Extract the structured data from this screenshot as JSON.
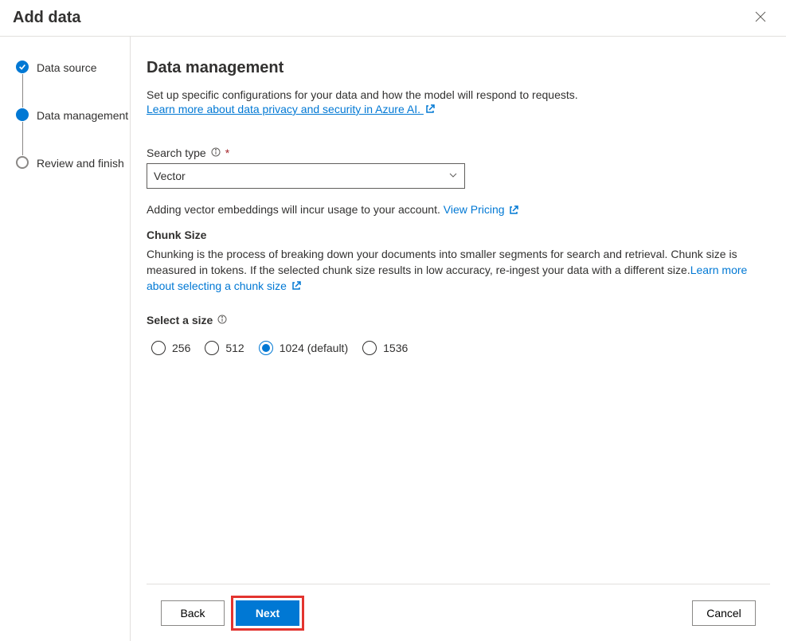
{
  "dialog": {
    "title": "Add data"
  },
  "wizard": {
    "steps": [
      {
        "label": "Data source",
        "state": "done"
      },
      {
        "label": "Data management",
        "state": "active"
      },
      {
        "label": "Review and finish",
        "state": "todo"
      }
    ]
  },
  "main": {
    "heading": "Data management",
    "description": "Set up specific configurations for your data and how the model will respond to requests.",
    "privacy_link": "Learn more about data privacy and security in Azure AI.",
    "search_type": {
      "label": "Search type",
      "selected": "Vector"
    },
    "pricing_hint_prefix": "Adding vector embeddings will incur usage to your account. ",
    "pricing_link": "View Pricing",
    "chunk": {
      "title": "Chunk Size",
      "desc_prefix": "Chunking is the process of breaking down your documents into smaller segments for search and retrieval. Chunk size is measured in tokens. If the selected chunk size results in low accuracy, re-ingest your data with a different size.",
      "learn_more": "Learn more about selecting a chunk size",
      "select_label": "Select a size",
      "options": [
        {
          "label": "256",
          "selected": false
        },
        {
          "label": "512",
          "selected": false
        },
        {
          "label": "1024 (default)",
          "selected": true
        },
        {
          "label": "1536",
          "selected": false
        }
      ]
    }
  },
  "footer": {
    "back": "Back",
    "next": "Next",
    "cancel": "Cancel"
  }
}
